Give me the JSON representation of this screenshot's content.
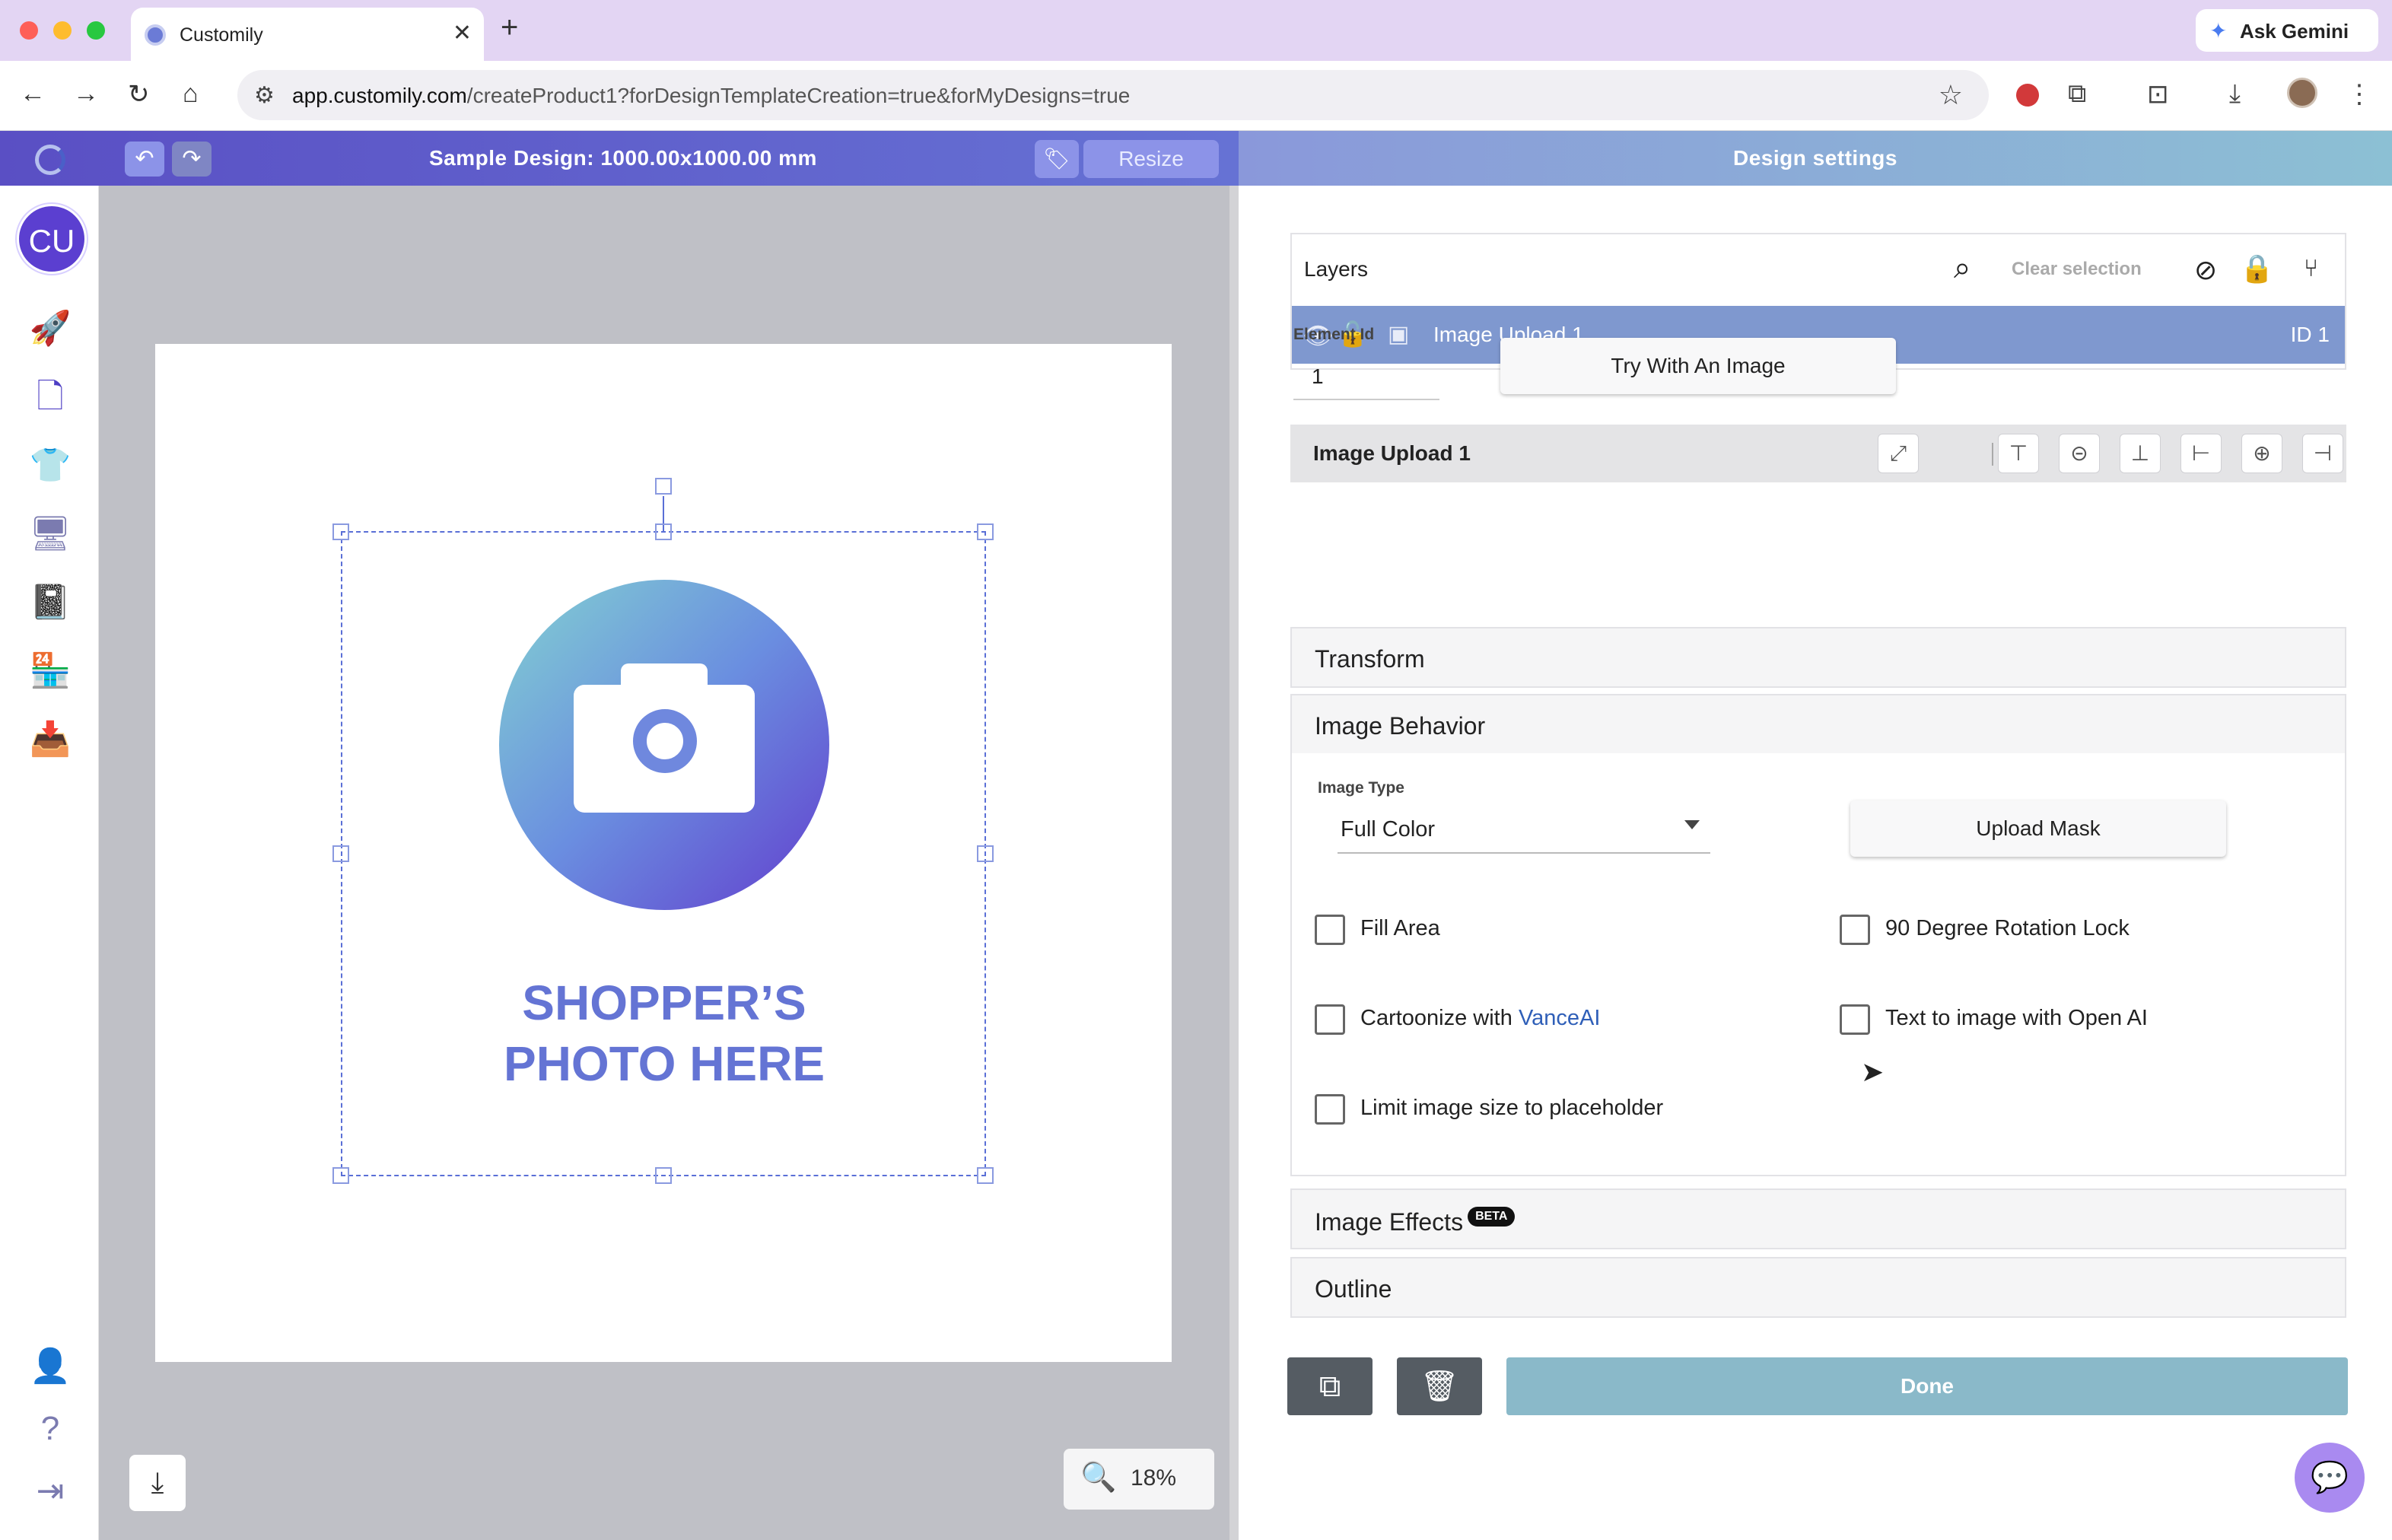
{
  "browser": {
    "tab_title": "Customily",
    "new_tab": "+",
    "tab_close": "✕",
    "gemini_label": "Ask Gemini",
    "url_host": "app.customily.com",
    "url_path": "/createProduct1?forDesignTemplateCreation=true&forMyDesigns=true"
  },
  "app_header": {
    "design_title": "Sample Design: 1000.00x1000.00 mm",
    "resize_label": "Resize",
    "settings_title": "Design settings"
  },
  "sidebar": {
    "avatar_initials": "CU"
  },
  "canvas": {
    "placeholder_line1": "SHOPPER’S",
    "placeholder_line2": "PHOTO HERE",
    "zoom": "18%"
  },
  "layers": {
    "title": "Layers",
    "clear_selection": "Clear selection",
    "items": [
      {
        "name": "Image Upload 1",
        "id": "ID 1"
      }
    ]
  },
  "element": {
    "title": "Image Upload 1",
    "element_id_label": "Element Id",
    "element_id_value": "1",
    "try_button": "Try With An Image"
  },
  "sections": {
    "transform": "Transform",
    "image_behavior": "Image Behavior",
    "image_effects": "Image Effects",
    "beta_badge": "BETA",
    "outline": "Outline"
  },
  "behavior": {
    "image_type_label": "Image Type",
    "image_type_value": "Full Color",
    "upload_mask": "Upload Mask",
    "fill_area": "Fill Area",
    "rotation_lock": "90 Degree Rotation Lock",
    "cartoonize_prefix": "Cartoonize with ",
    "cartoonize_link": "VanceAI",
    "text_to_image": "Text to image with Open AI",
    "limit_size": "Limit image size to placeholder"
  },
  "footer": {
    "done": "Done"
  },
  "colors": {
    "brand_purple": "#5a4fc4",
    "layer_selected": "#7f98cf",
    "done_button": "#8ab9c9",
    "placeholder_text": "#6474d4"
  }
}
